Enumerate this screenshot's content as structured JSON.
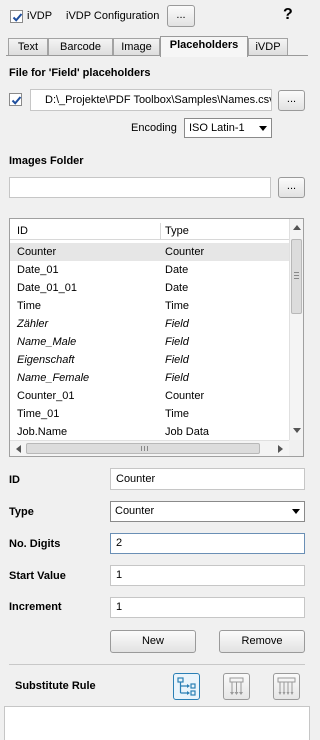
{
  "toolbar": {
    "ivdp_checkbox_label": "iVDP",
    "config_label": "iVDP Configuration",
    "more_button_label": "...",
    "help_label": "?"
  },
  "tabs": [
    {
      "label": "Text",
      "active": false
    },
    {
      "label": "Barcode",
      "active": false
    },
    {
      "label": "Image",
      "active": false
    },
    {
      "label": "Placeholders",
      "active": true
    },
    {
      "label": "iVDP",
      "active": false
    }
  ],
  "field_file": {
    "heading": "File for 'Field' placeholders",
    "path_value": "D:\\_Projekte\\PDF Toolbox\\Samples\\Names.csv",
    "browse_label": "...",
    "encoding_label": "Encoding",
    "encoding_value": "ISO Latin-1"
  },
  "images_folder": {
    "heading": "Images Folder",
    "path_value": "",
    "browse_label": "..."
  },
  "table": {
    "col_id": "ID",
    "col_type": "Type",
    "rows": [
      {
        "id": "Counter",
        "type": "Counter",
        "italic": false,
        "selected": true
      },
      {
        "id": "Date_01",
        "type": "Date",
        "italic": false,
        "selected": false
      },
      {
        "id": "Date_01_01",
        "type": "Date",
        "italic": false,
        "selected": false
      },
      {
        "id": "Time",
        "type": "Time",
        "italic": false,
        "selected": false
      },
      {
        "id": "Zähler",
        "type": "Field",
        "italic": true,
        "selected": false
      },
      {
        "id": "Name_Male",
        "type": "Field",
        "italic": true,
        "selected": false
      },
      {
        "id": "Eigenschaft",
        "type": "Field",
        "italic": true,
        "selected": false
      },
      {
        "id": "Name_Female",
        "type": "Field",
        "italic": true,
        "selected": false
      },
      {
        "id": "Counter_01",
        "type": "Counter",
        "italic": false,
        "selected": false
      },
      {
        "id": "Time_01",
        "type": "Time",
        "italic": false,
        "selected": false
      },
      {
        "id": "Job.Name",
        "type": "Job Data",
        "italic": false,
        "selected": false
      }
    ]
  },
  "details": {
    "id_label": "ID",
    "id_value": "Counter",
    "type_label": "Type",
    "type_value": "Counter",
    "digits_label": "No. Digits",
    "digits_value": "2",
    "start_label": "Start Value",
    "start_value": "1",
    "increment_label": "Increment",
    "increment_value": "1",
    "new_label": "New",
    "remove_label": "Remove"
  },
  "substitute": {
    "label": "Substitute Rule"
  },
  "colors": {
    "panel_bg": "#f0f0f0",
    "check_mark": "#1f4f9e",
    "active_icon": "#2a7fb5"
  }
}
